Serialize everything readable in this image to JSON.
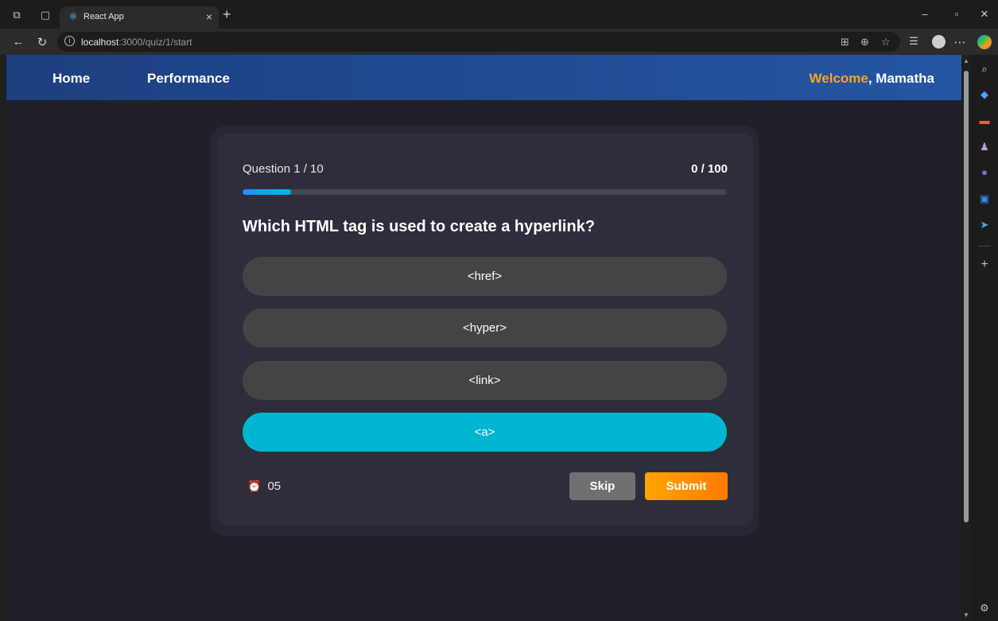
{
  "browser": {
    "tab_title": "React App",
    "url_host": "localhost",
    "url_path": ":3000/quiz/1/start"
  },
  "navbar": {
    "home": "Home",
    "performance": "Performance",
    "welcome_word": "Welcome",
    "welcome_rest": ", Mamatha"
  },
  "quiz": {
    "question_counter": "Question 1 / 10",
    "score": "0 / 100",
    "progress_fraction": 0.1,
    "question": "Which HTML tag is used to create a hyperlink?",
    "options": [
      "<href>",
      "<hyper>",
      "<link>",
      "<a>"
    ],
    "selected_option": "<a>",
    "timer": "05",
    "skip_label": "Skip",
    "submit_label": "Submit"
  },
  "colors": {
    "navbar": "#2456a3",
    "welcome_highlight": "#f5a623",
    "selected_option": "#00b6d1",
    "submit": "#ff8c00"
  }
}
